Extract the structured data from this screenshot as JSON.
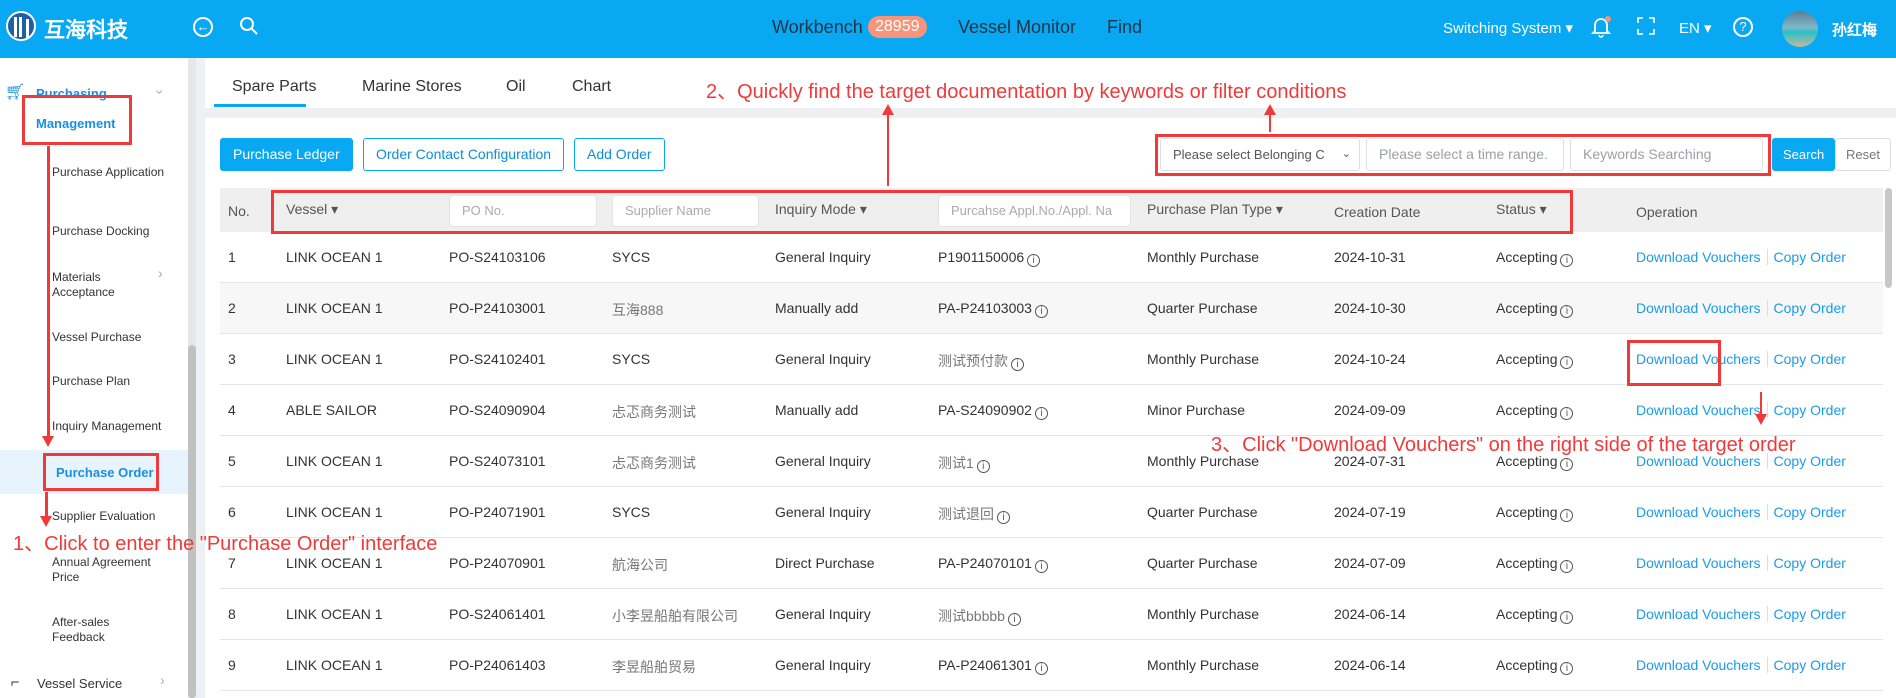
{
  "header": {
    "brand": "互海科技",
    "nav": [
      {
        "label": "Workbench",
        "badge": "28959"
      },
      {
        "label": "Vessel Monitor"
      },
      {
        "label": "Find"
      }
    ],
    "switching_system": "Switching System ▾",
    "language": "EN ▾",
    "user_name": "孙红梅"
  },
  "sidebar": {
    "group": {
      "label_line1": "Purchasing",
      "label_line2": "Management"
    },
    "items": [
      {
        "label": "Purchase Application"
      },
      {
        "label": "Purchase Docking"
      },
      {
        "label": "Materials Acceptance"
      },
      {
        "label": "Vessel Purchase"
      },
      {
        "label": "Purchase Plan"
      },
      {
        "label": "Inquiry Management"
      },
      {
        "label": "Purchase Order",
        "active": true
      },
      {
        "label": "Supplier Evaluation"
      },
      {
        "label": "Annual Agreement Price"
      },
      {
        "label": "After-sales Feedback"
      }
    ],
    "next_group": "Vessel Service"
  },
  "tabs": [
    "Spare Parts",
    "Marine Stores",
    "Oil",
    "Chart"
  ],
  "toolbar": {
    "purchase_ledger": "Purchase Ledger",
    "order_contact_config": "Order Contact Configuration",
    "add_order": "Add Order",
    "belonging_select": "Please select Belonging C",
    "time_range_placeholder": "Please select a time range.",
    "keywords_placeholder": "Keywords Searching",
    "search": "Search",
    "reset": "Reset"
  },
  "table": {
    "headers": {
      "no": "No.",
      "vessel": "Vessel ▾",
      "po_placeholder": "PO No.",
      "supplier_placeholder": "Supplier Name",
      "inquiry_mode": "Inquiry Mode ▾",
      "appl_placeholder": "Purcahse Appl.No./Appl. Na",
      "plan_type": "Purchase Plan Type ▾",
      "creation_date": "Creation Date",
      "status": "Status ▾",
      "operation": "Operation"
    },
    "rows": [
      {
        "no": "1",
        "vessel": "LINK OCEAN 1",
        "po": "PO-S24103106",
        "supplier": "SYCS",
        "mode": "General Inquiry",
        "appl": "P1901150006",
        "plan": "Monthly Purchase",
        "date": "2024-10-31",
        "status": "Accepting"
      },
      {
        "no": "2",
        "vessel": "LINK OCEAN 1",
        "po": "PO-P24103001",
        "supplier": "互海888",
        "mode": "Manually add",
        "appl": "PA-P24103003",
        "plan": "Quarter Purchase",
        "date": "2024-10-30",
        "status": "Accepting"
      },
      {
        "no": "3",
        "vessel": "LINK OCEAN 1",
        "po": "PO-S24102401",
        "supplier": "SYCS",
        "mode": "General Inquiry",
        "appl": "测试预付款",
        "plan": "Monthly Purchase",
        "date": "2024-10-24",
        "status": "Accepting"
      },
      {
        "no": "4",
        "vessel": "ABLE SAILOR",
        "po": "PO-S24090904",
        "supplier": "忐忑商务测试",
        "mode": "Manually add",
        "appl": "PA-S24090902",
        "plan": "Minor Purchase",
        "date": "2024-09-09",
        "status": "Accepting"
      },
      {
        "no": "5",
        "vessel": "LINK OCEAN 1",
        "po": "PO-S24073101",
        "supplier": "忐忑商务测试",
        "mode": "General Inquiry",
        "appl": "测试1",
        "plan": "Monthly Purchase",
        "date": "2024-07-31",
        "status": "Accepting"
      },
      {
        "no": "6",
        "vessel": "LINK OCEAN 1",
        "po": "PO-P24071901",
        "supplier": "SYCS",
        "mode": "General Inquiry",
        "appl": "测试退回",
        "plan": "Quarter Purchase",
        "date": "2024-07-19",
        "status": "Accepting"
      },
      {
        "no": "7",
        "vessel": "LINK OCEAN 1",
        "po": "PO-P24070901",
        "supplier": "航海公司",
        "mode": "Direct Purchase",
        "appl": "PA-P24070101",
        "plan": "Quarter Purchase",
        "date": "2024-07-09",
        "status": "Accepting"
      },
      {
        "no": "8",
        "vessel": "LINK OCEAN 1",
        "po": "PO-S24061401",
        "supplier": "小李昱船舶有限公司",
        "mode": "General Inquiry",
        "appl": "测试bbbbb",
        "plan": "Monthly Purchase",
        "date": "2024-06-14",
        "status": "Accepting"
      },
      {
        "no": "9",
        "vessel": "LINK OCEAN 1",
        "po": "PO-P24061403",
        "supplier": "李昱船舶贸易",
        "mode": "General Inquiry",
        "appl": "PA-P24061301",
        "plan": "Monthly Purchase",
        "date": "2024-06-14",
        "status": "Accepting"
      }
    ],
    "op_download": "Download Vouchers",
    "op_copy": "Copy Order"
  },
  "annotations": {
    "step1": "1、Click to enter the \"Purchase Order\" interface",
    "step2": "2、Quickly find the target documentation by keywords or filter conditions",
    "step3": "3、Click \"Download Vouchers\" on the right side of the target order"
  },
  "colors": {
    "primary": "#08a9f2",
    "link": "#1a9be8",
    "annotation": "#f03a3a",
    "badge": "#f7947a"
  }
}
